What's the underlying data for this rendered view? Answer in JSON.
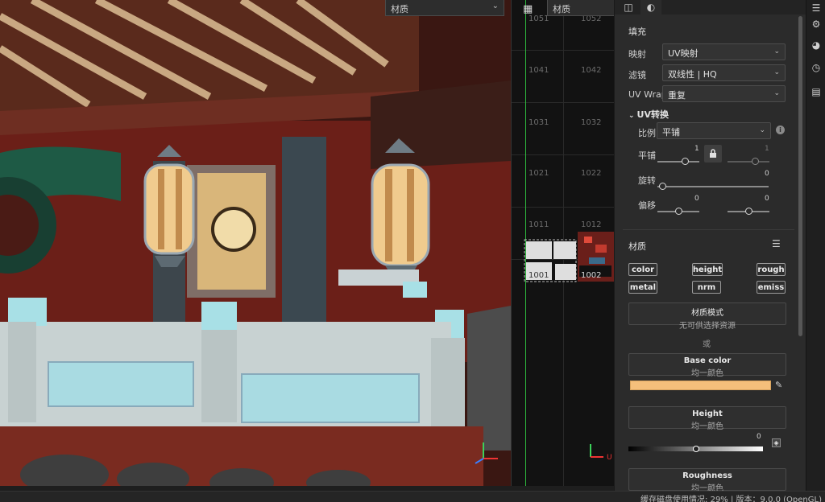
{
  "viewport": {
    "material_dropdown": "材质",
    "chevron_icon": "chevron-down-icon"
  },
  "uv_view": {
    "dropdown": "材质",
    "tile_labels": [
      "1051",
      "1052",
      "1041",
      "1042",
      "1031",
      "1032",
      "1021",
      "1022",
      "1011",
      "1012",
      "1001",
      "1002"
    ],
    "axis_label_u": "U",
    "grid_icon": "grid-icon"
  },
  "panel": {
    "tabs": [
      "camera-settings-icon",
      "display-mode-icon"
    ],
    "fill_section": "填充",
    "mapping": {
      "label": "映射",
      "value": "UV映射"
    },
    "filter": {
      "label": "滤镜",
      "value": "双线性 | HQ"
    },
    "uv_wrap": {
      "label": "UV Wrap",
      "value": "重复"
    },
    "uv_transform": {
      "title": "UV转换",
      "scale_label": "比例",
      "scale_value": "平铺",
      "tile_label": "平铺",
      "tile_value_1": "1",
      "tile_value_2": "1",
      "rotate_label": "旋转",
      "rotate_value": "0",
      "offset_label": "偏移",
      "offset_value_1": "0",
      "offset_value_2": "0"
    },
    "material_section": {
      "title": "材质",
      "channels": [
        "color",
        "height",
        "rough",
        "metal",
        "nrm",
        "emiss"
      ],
      "material_mode": {
        "title": "材质模式",
        "subtitle": "无可供选择资源"
      },
      "or_text": "或",
      "base_color": {
        "title": "Base color",
        "subtitle": "均一颜色",
        "swatch": "#f5bf7b"
      },
      "height": {
        "title": "Height",
        "subtitle": "均一颜色",
        "value": "0",
        "level": 0.5
      },
      "roughness": {
        "title": "Roughness",
        "subtitle": "均一颜色"
      }
    }
  },
  "right_toolbar": [
    "layers-icon",
    "settings-icon",
    "shader-icon",
    "history-icon",
    "properties-icon"
  ],
  "statusbar": {
    "text": "缓存磁盘使用情况:    29% | 版本：9.0.0 (OpenGL)"
  }
}
